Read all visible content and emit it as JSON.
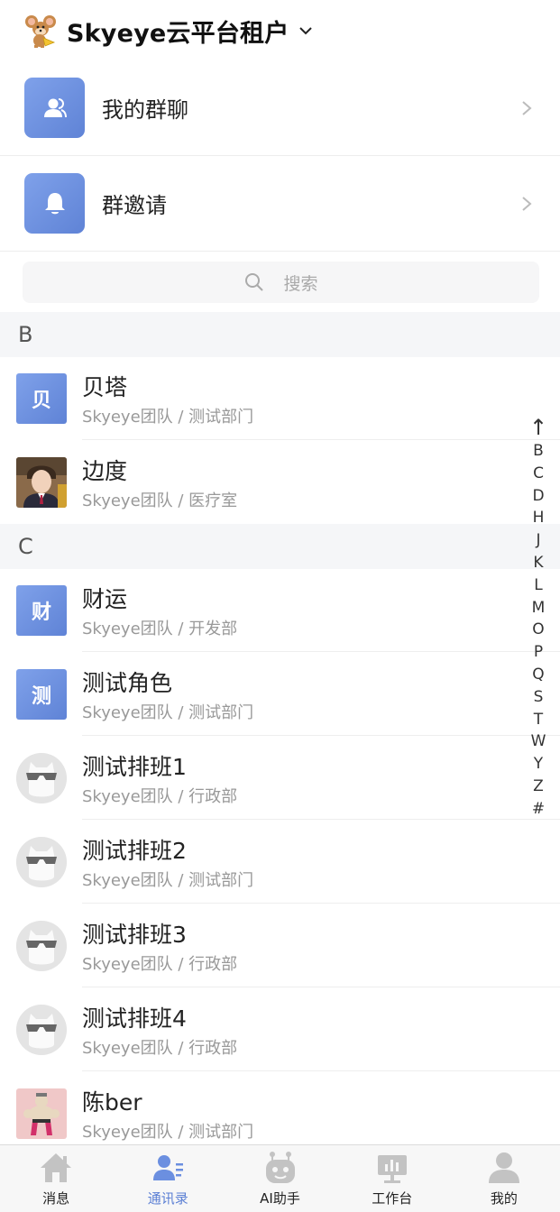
{
  "header": {
    "tenant_name": "Skyeye云平台租户"
  },
  "entries": [
    {
      "label": "我的群聊"
    },
    {
      "label": "群邀请"
    }
  ],
  "search": {
    "placeholder": "搜索"
  },
  "sections": [
    {
      "letter": "B",
      "contacts": [
        {
          "name": "贝塔",
          "org": "Skyeye团队 / 测试部门",
          "avatar_text": "贝",
          "avatar_type": "initial"
        },
        {
          "name": "边度",
          "org": "Skyeye团队 / 医疗室",
          "avatar_type": "photo"
        }
      ]
    },
    {
      "letter": "C",
      "contacts": [
        {
          "name": "财运",
          "org": "Skyeye团队 / 开发部",
          "avatar_text": "财",
          "avatar_type": "initial"
        },
        {
          "name": "测试角色",
          "org": "Skyeye团队 / 测试部门",
          "avatar_text": "测",
          "avatar_type": "initial"
        },
        {
          "name": "测试排班1",
          "org": "Skyeye团队 / 行政部",
          "avatar_type": "default"
        },
        {
          "name": "测试排班2",
          "org": "Skyeye团队 / 测试部门",
          "avatar_type": "default"
        },
        {
          "name": "测试排班3",
          "org": "Skyeye团队 / 行政部",
          "avatar_type": "default"
        },
        {
          "name": "测试排班4",
          "org": "Skyeye团队 / 行政部",
          "avatar_type": "default"
        },
        {
          "name": "陈ber",
          "org": "Skyeye团队 / 测试部门",
          "avatar_type": "cartoon"
        }
      ]
    }
  ],
  "index_bar": {
    "up": "↑",
    "letters": [
      "B",
      "C",
      "D",
      "H",
      "J",
      "K",
      "L",
      "M",
      "O",
      "P",
      "Q",
      "S",
      "T",
      "W",
      "Y",
      "Z",
      "#"
    ]
  },
  "tabbar": {
    "active": "通讯录",
    "tabs": [
      {
        "label": "消息",
        "icon": "home-icon"
      },
      {
        "label": "通讯录",
        "icon": "contacts-icon"
      },
      {
        "label": "AI助手",
        "icon": "robot-icon"
      },
      {
        "label": "工作台",
        "icon": "workbench-icon"
      },
      {
        "label": "我的",
        "icon": "profile-icon"
      }
    ]
  },
  "colors": {
    "accent": "#5f83d6",
    "section_bg": "#f5f6f8",
    "muted_text": "#999999"
  }
}
